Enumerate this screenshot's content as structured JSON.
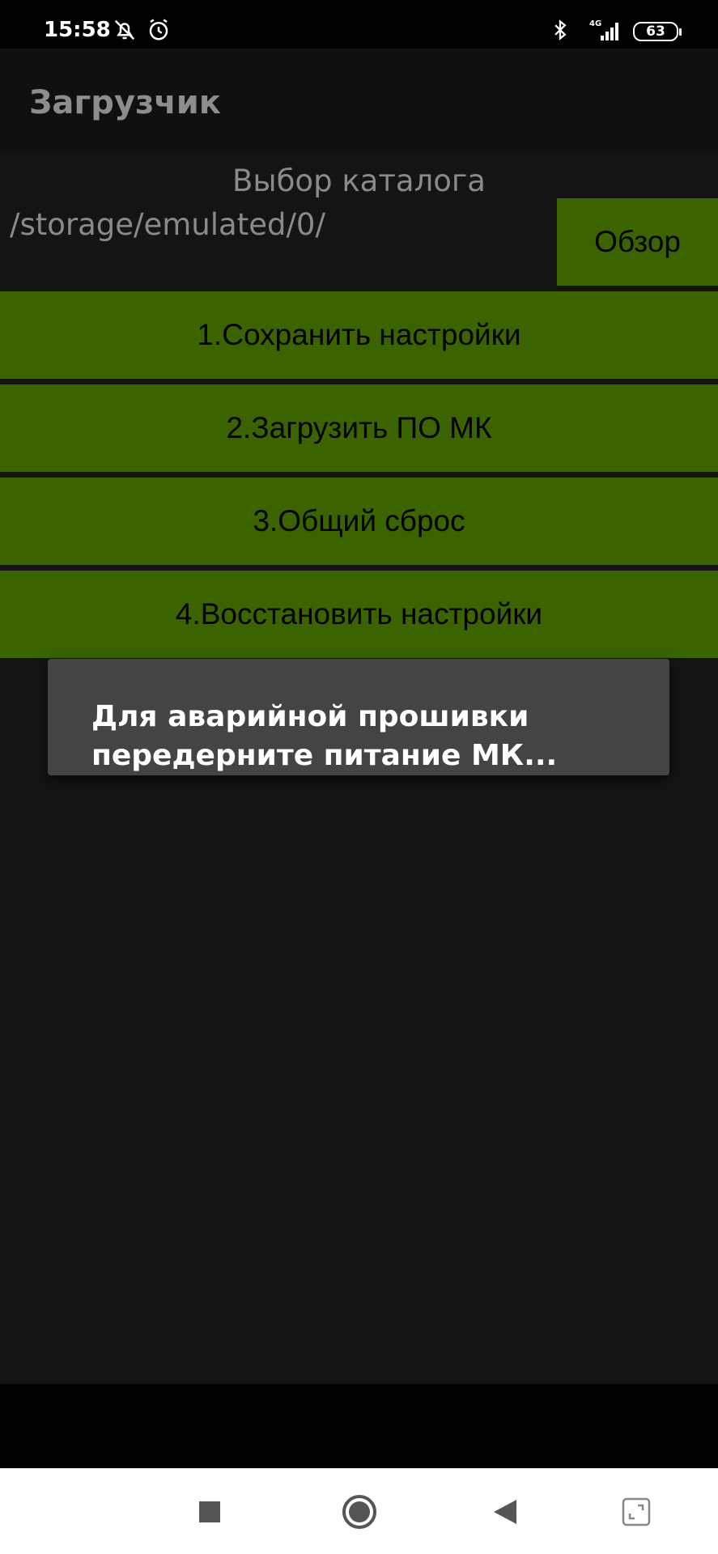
{
  "status_bar": {
    "time": "15:58",
    "battery": "63",
    "network": "4G",
    "icons": [
      "bell-off-icon",
      "alarm-icon",
      "bluetooth-icon",
      "signal-icon",
      "battery-icon"
    ]
  },
  "app_bar": {
    "title": "Загрузчик"
  },
  "directory": {
    "label": "Выбор каталога",
    "path": "/storage/emulated/0/",
    "browse_label": "Обзор"
  },
  "actions": [
    {
      "label": "1.Сохранить настройки"
    },
    {
      "label": "2.Загрузить ПО МК"
    },
    {
      "label": "3.Общий сброс"
    },
    {
      "label": "4.Восстановить настройки"
    }
  ],
  "toast": {
    "message": "Для аварийной прошивки передерните питание МК..."
  },
  "nav_bar": {
    "buttons": [
      "recents-icon",
      "home-icon",
      "back-icon",
      "screenshot-expand-icon"
    ]
  },
  "colors": {
    "accent_green": "#3b6400",
    "background": "#141414",
    "app_bar": "#101010",
    "toast": "#444444",
    "muted_text": "#8a8a8a"
  }
}
